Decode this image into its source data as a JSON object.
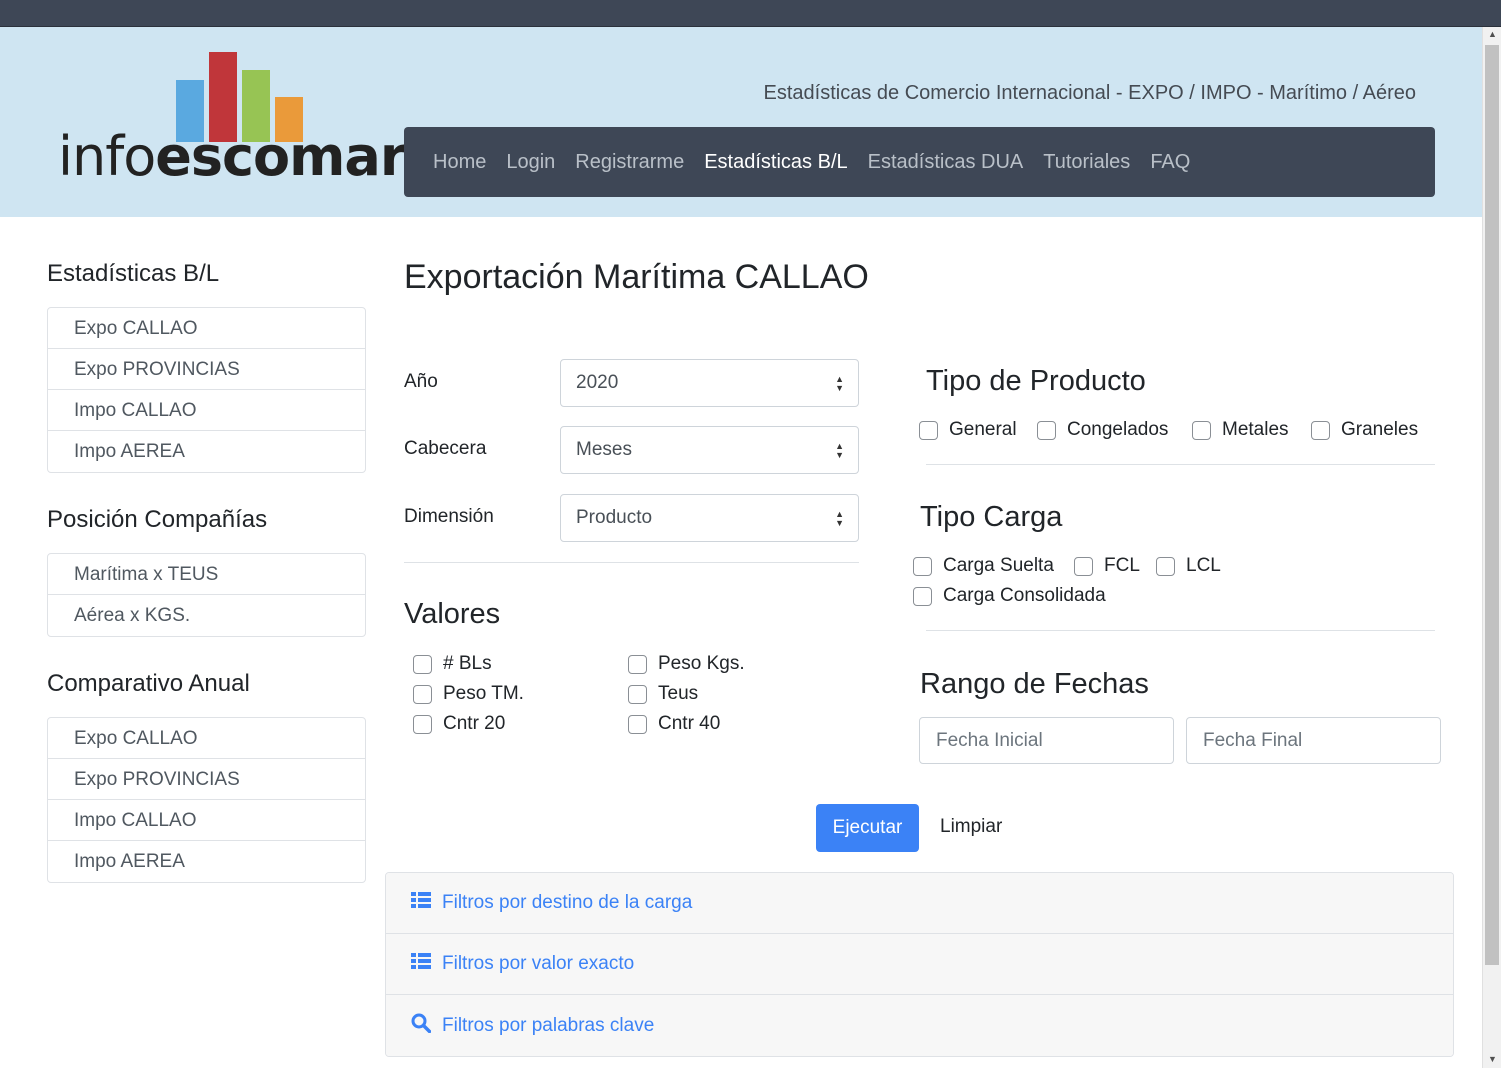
{
  "header": {
    "logo_text_light": "info",
    "logo_text_bold": "escomar",
    "tagline": "Estadísticas de Comercio Internacional - EXPO / IMPO - Marítimo / Aéreo",
    "brand_colors": [
      "#5aa9e0",
      "#c0363a",
      "#97c454",
      "#ea9a3a"
    ]
  },
  "nav": {
    "items": [
      {
        "label": "Home"
      },
      {
        "label": "Login"
      },
      {
        "label": "Registrarme"
      },
      {
        "label": "Estadísticas B/L",
        "active": true
      },
      {
        "label": "Estadísticas DUA"
      },
      {
        "label": "Tutoriales"
      },
      {
        "label": "FAQ"
      }
    ]
  },
  "sidebar": {
    "sections": [
      {
        "title": "Estadísticas B/L",
        "items": [
          "Expo CALLAO",
          "Expo PROVINCIAS",
          "Impo CALLAO",
          "Impo AEREA"
        ]
      },
      {
        "title": "Posición Compañías",
        "items": [
          "Marítima x TEUS",
          "Aérea x KGS."
        ]
      },
      {
        "title": "Comparativo Anual",
        "items": [
          "Expo CALLAO",
          "Expo PROVINCIAS",
          "Impo CALLAO",
          "Impo AEREA"
        ]
      }
    ]
  },
  "main": {
    "title": "Exportación Marítima CALLAO",
    "fields": {
      "anio": {
        "label": "Año",
        "value": "2020"
      },
      "cabecera": {
        "label": "Cabecera",
        "value": "Meses"
      },
      "dimension": {
        "label": "Dimensión",
        "value": "Producto"
      }
    },
    "valores": {
      "title": "Valores",
      "options": [
        "# BLs",
        "Peso Kgs.",
        "Peso TM.",
        "Teus",
        "Cntr 20",
        "Cntr 40"
      ]
    },
    "tipo_producto": {
      "title": "Tipo de Producto",
      "options": [
        "General",
        "Congelados",
        "Metales",
        "Graneles"
      ]
    },
    "tipo_carga": {
      "title": "Tipo Carga",
      "options": [
        "Carga Suelta",
        "FCL",
        "LCL",
        "Carga Consolidada"
      ]
    },
    "rango_fechas": {
      "title": "Rango de Fechas",
      "start_placeholder": "Fecha Inicial",
      "end_placeholder": "Fecha Final"
    },
    "buttons": {
      "run": "Ejecutar",
      "clear": "Limpiar"
    },
    "accordion": [
      {
        "label": "Filtros por destino de la carga",
        "icon": "list-icon"
      },
      {
        "label": "Filtros por valor exacto",
        "icon": "list-icon"
      },
      {
        "label": "Filtros por palabras clave",
        "icon": "search-icon"
      }
    ]
  },
  "colors": {
    "accent": "#3b82f6",
    "navbar": "#3e4756",
    "header_bg": "#cfe5f2"
  }
}
